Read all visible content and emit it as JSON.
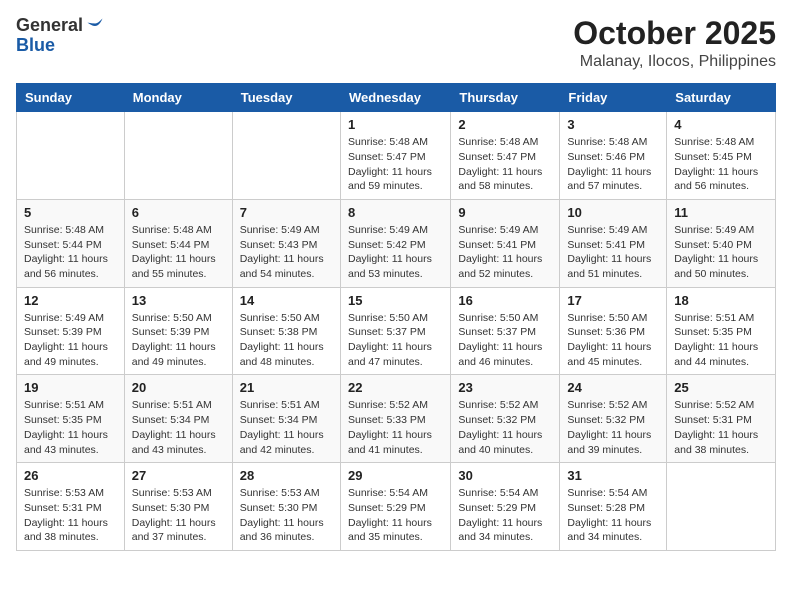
{
  "header": {
    "logo_line1": "General",
    "logo_line2": "Blue",
    "month": "October 2025",
    "location": "Malanay, Ilocos, Philippines"
  },
  "days_of_week": [
    "Sunday",
    "Monday",
    "Tuesday",
    "Wednesday",
    "Thursday",
    "Friday",
    "Saturday"
  ],
  "weeks": [
    [
      {
        "day": "",
        "sunrise": "",
        "sunset": "",
        "daylight": ""
      },
      {
        "day": "",
        "sunrise": "",
        "sunset": "",
        "daylight": ""
      },
      {
        "day": "",
        "sunrise": "",
        "sunset": "",
        "daylight": ""
      },
      {
        "day": "1",
        "sunrise": "Sunrise: 5:48 AM",
        "sunset": "Sunset: 5:47 PM",
        "daylight": "Daylight: 11 hours and 59 minutes."
      },
      {
        "day": "2",
        "sunrise": "Sunrise: 5:48 AM",
        "sunset": "Sunset: 5:47 PM",
        "daylight": "Daylight: 11 hours and 58 minutes."
      },
      {
        "day": "3",
        "sunrise": "Sunrise: 5:48 AM",
        "sunset": "Sunset: 5:46 PM",
        "daylight": "Daylight: 11 hours and 57 minutes."
      },
      {
        "day": "4",
        "sunrise": "Sunrise: 5:48 AM",
        "sunset": "Sunset: 5:45 PM",
        "daylight": "Daylight: 11 hours and 56 minutes."
      }
    ],
    [
      {
        "day": "5",
        "sunrise": "Sunrise: 5:48 AM",
        "sunset": "Sunset: 5:44 PM",
        "daylight": "Daylight: 11 hours and 56 minutes."
      },
      {
        "day": "6",
        "sunrise": "Sunrise: 5:48 AM",
        "sunset": "Sunset: 5:44 PM",
        "daylight": "Daylight: 11 hours and 55 minutes."
      },
      {
        "day": "7",
        "sunrise": "Sunrise: 5:49 AM",
        "sunset": "Sunset: 5:43 PM",
        "daylight": "Daylight: 11 hours and 54 minutes."
      },
      {
        "day": "8",
        "sunrise": "Sunrise: 5:49 AM",
        "sunset": "Sunset: 5:42 PM",
        "daylight": "Daylight: 11 hours and 53 minutes."
      },
      {
        "day": "9",
        "sunrise": "Sunrise: 5:49 AM",
        "sunset": "Sunset: 5:41 PM",
        "daylight": "Daylight: 11 hours and 52 minutes."
      },
      {
        "day": "10",
        "sunrise": "Sunrise: 5:49 AM",
        "sunset": "Sunset: 5:41 PM",
        "daylight": "Daylight: 11 hours and 51 minutes."
      },
      {
        "day": "11",
        "sunrise": "Sunrise: 5:49 AM",
        "sunset": "Sunset: 5:40 PM",
        "daylight": "Daylight: 11 hours and 50 minutes."
      }
    ],
    [
      {
        "day": "12",
        "sunrise": "Sunrise: 5:49 AM",
        "sunset": "Sunset: 5:39 PM",
        "daylight": "Daylight: 11 hours and 49 minutes."
      },
      {
        "day": "13",
        "sunrise": "Sunrise: 5:50 AM",
        "sunset": "Sunset: 5:39 PM",
        "daylight": "Daylight: 11 hours and 49 minutes."
      },
      {
        "day": "14",
        "sunrise": "Sunrise: 5:50 AM",
        "sunset": "Sunset: 5:38 PM",
        "daylight": "Daylight: 11 hours and 48 minutes."
      },
      {
        "day": "15",
        "sunrise": "Sunrise: 5:50 AM",
        "sunset": "Sunset: 5:37 PM",
        "daylight": "Daylight: 11 hours and 47 minutes."
      },
      {
        "day": "16",
        "sunrise": "Sunrise: 5:50 AM",
        "sunset": "Sunset: 5:37 PM",
        "daylight": "Daylight: 11 hours and 46 minutes."
      },
      {
        "day": "17",
        "sunrise": "Sunrise: 5:50 AM",
        "sunset": "Sunset: 5:36 PM",
        "daylight": "Daylight: 11 hours and 45 minutes."
      },
      {
        "day": "18",
        "sunrise": "Sunrise: 5:51 AM",
        "sunset": "Sunset: 5:35 PM",
        "daylight": "Daylight: 11 hours and 44 minutes."
      }
    ],
    [
      {
        "day": "19",
        "sunrise": "Sunrise: 5:51 AM",
        "sunset": "Sunset: 5:35 PM",
        "daylight": "Daylight: 11 hours and 43 minutes."
      },
      {
        "day": "20",
        "sunrise": "Sunrise: 5:51 AM",
        "sunset": "Sunset: 5:34 PM",
        "daylight": "Daylight: 11 hours and 43 minutes."
      },
      {
        "day": "21",
        "sunrise": "Sunrise: 5:51 AM",
        "sunset": "Sunset: 5:34 PM",
        "daylight": "Daylight: 11 hours and 42 minutes."
      },
      {
        "day": "22",
        "sunrise": "Sunrise: 5:52 AM",
        "sunset": "Sunset: 5:33 PM",
        "daylight": "Daylight: 11 hours and 41 minutes."
      },
      {
        "day": "23",
        "sunrise": "Sunrise: 5:52 AM",
        "sunset": "Sunset: 5:32 PM",
        "daylight": "Daylight: 11 hours and 40 minutes."
      },
      {
        "day": "24",
        "sunrise": "Sunrise: 5:52 AM",
        "sunset": "Sunset: 5:32 PM",
        "daylight": "Daylight: 11 hours and 39 minutes."
      },
      {
        "day": "25",
        "sunrise": "Sunrise: 5:52 AM",
        "sunset": "Sunset: 5:31 PM",
        "daylight": "Daylight: 11 hours and 38 minutes."
      }
    ],
    [
      {
        "day": "26",
        "sunrise": "Sunrise: 5:53 AM",
        "sunset": "Sunset: 5:31 PM",
        "daylight": "Daylight: 11 hours and 38 minutes."
      },
      {
        "day": "27",
        "sunrise": "Sunrise: 5:53 AM",
        "sunset": "Sunset: 5:30 PM",
        "daylight": "Daylight: 11 hours and 37 minutes."
      },
      {
        "day": "28",
        "sunrise": "Sunrise: 5:53 AM",
        "sunset": "Sunset: 5:30 PM",
        "daylight": "Daylight: 11 hours and 36 minutes."
      },
      {
        "day": "29",
        "sunrise": "Sunrise: 5:54 AM",
        "sunset": "Sunset: 5:29 PM",
        "daylight": "Daylight: 11 hours and 35 minutes."
      },
      {
        "day": "30",
        "sunrise": "Sunrise: 5:54 AM",
        "sunset": "Sunset: 5:29 PM",
        "daylight": "Daylight: 11 hours and 34 minutes."
      },
      {
        "day": "31",
        "sunrise": "Sunrise: 5:54 AM",
        "sunset": "Sunset: 5:28 PM",
        "daylight": "Daylight: 11 hours and 34 minutes."
      },
      {
        "day": "",
        "sunrise": "",
        "sunset": "",
        "daylight": ""
      }
    ]
  ]
}
